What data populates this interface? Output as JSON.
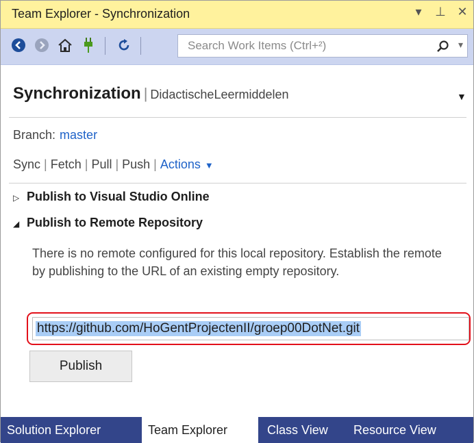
{
  "window": {
    "title": "Team Explorer - Synchronization",
    "controls": {
      "dropdown": "▾",
      "pin": "⊥",
      "close": "✕"
    }
  },
  "toolbar": {
    "search_placeholder": "Search Work Items (Ctrl+²)"
  },
  "header": {
    "title": "Synchronization",
    "separator": "|",
    "subtitle": "DidactischeLeermiddelen"
  },
  "branch": {
    "label": "Branch:",
    "value": "master"
  },
  "actions": {
    "sync": "Sync",
    "fetch": "Fetch",
    "pull": "Pull",
    "push": "Push",
    "actions_label": "Actions",
    "sep": "|"
  },
  "sections": {
    "publish_vso": {
      "label": "Publish to Visual Studio Online",
      "expanded": false
    },
    "publish_remote": {
      "label": "Publish to Remote Repository",
      "expanded": true,
      "description": "There is no remote configured for this local repository. Establish the remote by publishing to the URL of an existing empty repository.",
      "url": "https://github.com/HoGentProjectenII/groep00DotNet.git",
      "button": "Publish"
    }
  },
  "tabs": [
    {
      "label": "Solution Explorer",
      "active": false
    },
    {
      "label": "Team Explorer",
      "active": true
    },
    {
      "label": "Class View",
      "active": false
    },
    {
      "label": "Resource View",
      "active": false
    }
  ],
  "colors": {
    "title_bar": "#fff29d",
    "toolbar": "#ccd5f0",
    "link": "#1e62c8",
    "tab_bar": "#33458a",
    "highlight_outline": "#e2101a",
    "selection": "#a9cdf6"
  }
}
